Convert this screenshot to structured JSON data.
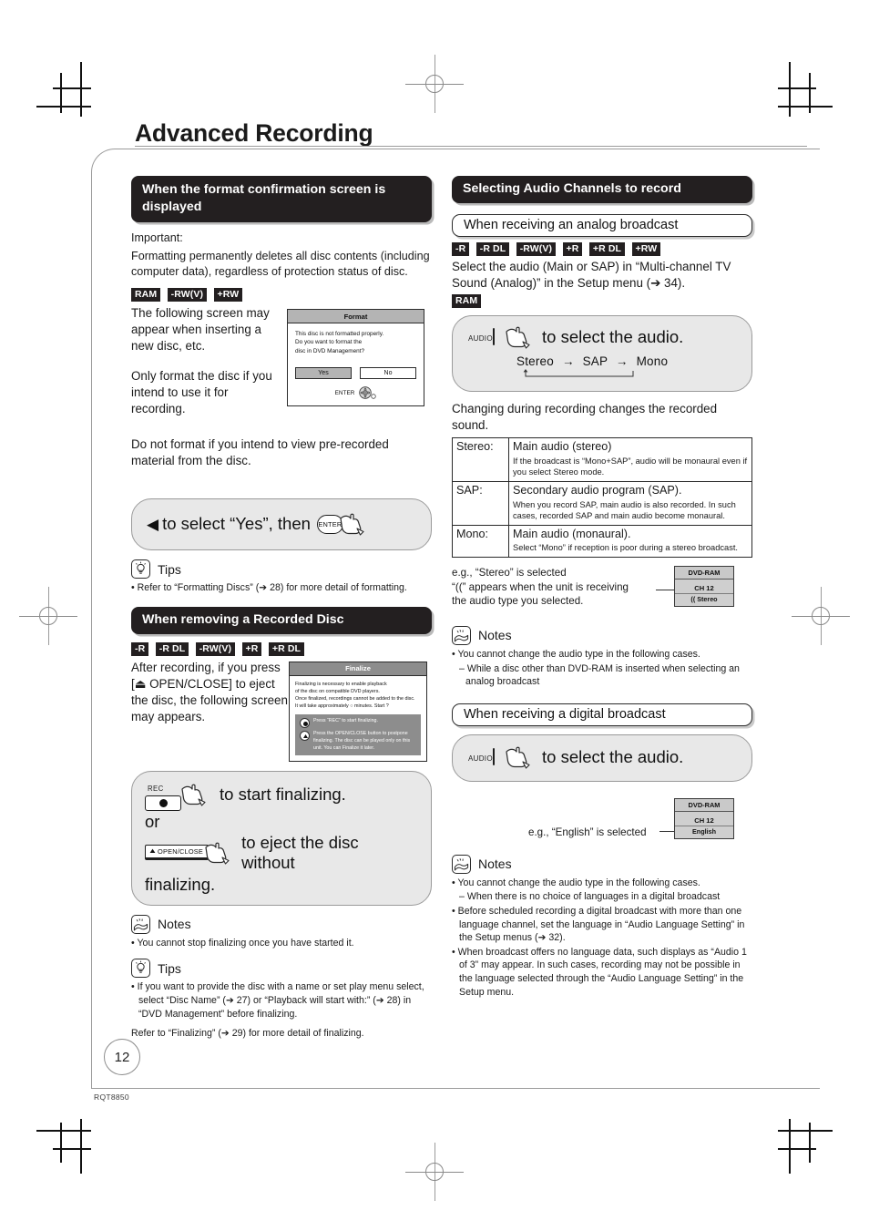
{
  "document": {
    "title": "Advanced Recording",
    "page_number": "12",
    "code": "RQT8850"
  },
  "left": {
    "section1": {
      "heading": "When the format confirmation screen is displayed",
      "important_label": "Important:",
      "important_body": "Formatting permanently deletes all disc contents (including computer data), regardless of protection status of disc.",
      "badges": [
        "RAM",
        "-RW(V)",
        "+RW"
      ],
      "para1": "The following screen may appear when inserting a new disc, etc.",
      "para2": "Only format the disc if you intend to use it for recording.",
      "para3": "Do not format if you intend to view pre-recorded material from the disc.",
      "format_screen": {
        "title": "Format",
        "message_l1": "This disc is not formatted properly.",
        "message_l2": "Do you want to format the",
        "message_l3": "disc in DVD Management?",
        "yes": "Yes",
        "no": "No",
        "enter": "ENTER"
      },
      "panel": {
        "arrow": "◀",
        "text": "to select “Yes”, then",
        "key": "ENTER"
      },
      "tips_label": "Tips",
      "tips_items": [
        "• Refer to “Formatting Discs” (➔ 28) for more detail of formatting."
      ]
    },
    "section2": {
      "heading": "When removing a Recorded Disc",
      "badges": [
        "-R",
        "-R DL",
        "-RW(V)",
        "+R",
        "+R DL"
      ],
      "para1": "After recording, if you press [⏏ OPEN/CLOSE] to eject the disc, the following screen may appears.",
      "finalize_screen": {
        "title": "Finalize",
        "msg_l1": "Finalizing is necessary to enable playback",
        "msg_l2": "of the disc on compatible DVD players.",
        "msg_l3": "Once finalized, recordings cannot be added to the disc.",
        "msg_l4": "It will take approximately ○ minutes. Start ?",
        "opt1": "Press “REC” to start finalizing.",
        "opt2": "Press the OPEN/CLOSE button to postpone finalizing. The disc can be played only on this unit. You can Finalize it later."
      },
      "panel": {
        "rec_cap": "REC",
        "rec_text": "to start finalizing.",
        "or": "or",
        "open_cap": "OPEN/CLOSE",
        "open_text": "to eject the disc without",
        "tail": "finalizing."
      },
      "notes_label": "Notes",
      "notes_items": [
        "• You cannot stop finalizing once you have started it."
      ],
      "tips_label": "Tips",
      "tips_items": [
        "• If you want to provide the disc with a name or set play menu select, select “Disc Name” (➔ 27) or “Playback will start with:” (➔ 28) in “DVD Management” before finalizing."
      ],
      "tips_footer": "Refer to “Finalizing” (➔ 29) for more detail of finalizing."
    }
  },
  "right": {
    "heading": "Selecting Audio Channels to record",
    "analog": {
      "subheading": "When receiving an analog broadcast",
      "badges": [
        "-R",
        "-R DL",
        "-RW(V)",
        "+R",
        "+R DL",
        "+RW"
      ],
      "body": "Select the audio (Main or SAP) in “Multi-channel TV Sound (Analog)” in the Setup menu (➔ 34).",
      "ram_badge": "RAM",
      "panel": {
        "key_cap": "AUDIO",
        "text": "to select the audio.",
        "cycle": [
          "Stereo",
          "SAP",
          "Mono"
        ],
        "cycle_arrow": "→"
      },
      "after_panel": "Changing during recording changes the recorded sound.",
      "table": [
        {
          "key": "Stereo:",
          "main": "Main audio (stereo)",
          "sub": "If the broadcast is “Mono+SAP”, audio will be monaural even if you select Stereo mode."
        },
        {
          "key": "SAP:",
          "main": "Secondary audio program (SAP).",
          "sub": "When you record SAP, main audio is also recorded. In such cases, recorded SAP and main audio become monaural."
        },
        {
          "key": "Mono:",
          "main": "Main audio (monaural).",
          "sub": "Select “Mono” if reception is poor during a stereo broadcast."
        }
      ],
      "eg_l1": "e.g., “Stereo” is selected",
      "eg_l2": "“((” appears when the unit is receiving",
      "eg_l3": "the audio type you selected.",
      "display": {
        "title": "DVD-RAM",
        "channel": "CH 12",
        "mode": "(( Stereo"
      },
      "notes_label": "Notes",
      "notes_items": [
        "• You cannot change the audio type in the following cases.",
        "– While a disc other than DVD-RAM is inserted when selecting an analog broadcast"
      ]
    },
    "digital": {
      "subheading": "When receiving a digital broadcast",
      "panel": {
        "key_cap": "AUDIO",
        "text": "to select the audio."
      },
      "eg": "e.g., “English” is selected",
      "display": {
        "title": "DVD-RAM",
        "channel": "CH 12",
        "mode": "English"
      },
      "notes_label": "Notes",
      "notes_items": [
        "• You cannot change the audio type in the following cases.",
        "– When there is no choice of languages in a digital broadcast",
        "• Before scheduled recording a digital broadcast with more than one language channel, set the language in “Audio Language Setting” in the Setup menus (➔ 32).",
        "• When broadcast offers no language data, such displays as “Audio 1 of 3” may appear. In such cases, recording may not be possible in the language selected through the “Audio Language Setting” in the Setup menu."
      ]
    }
  }
}
